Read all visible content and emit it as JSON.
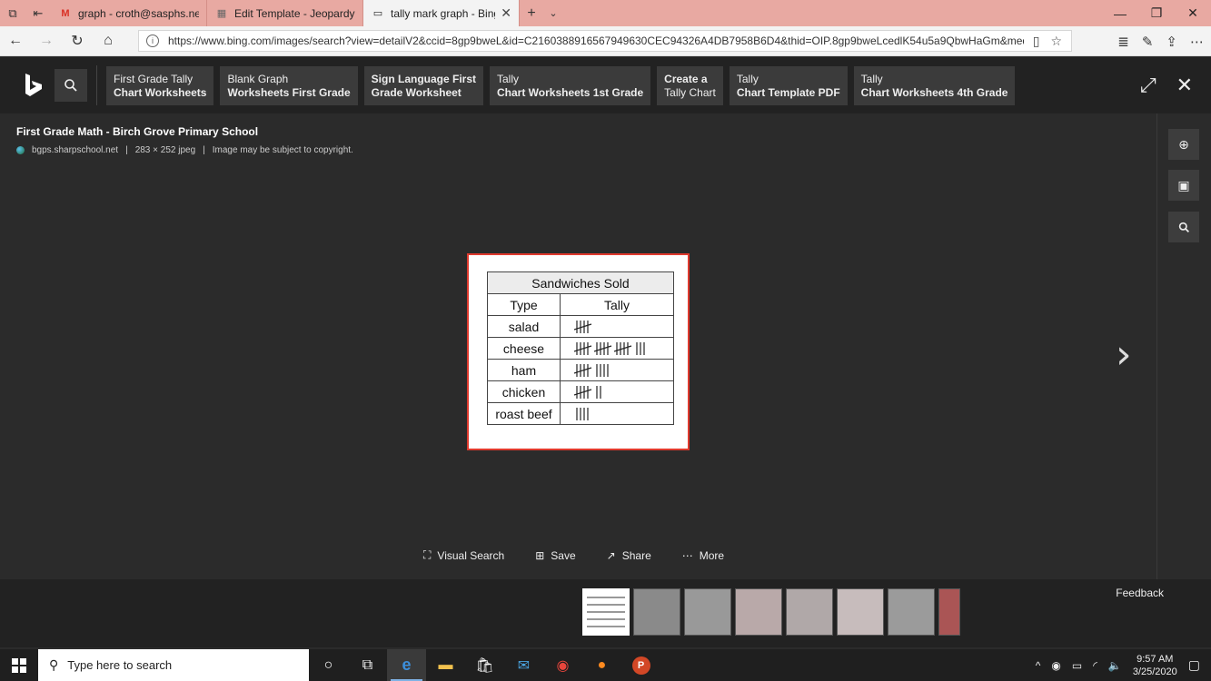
{
  "browser": {
    "tabs": [
      {
        "title": "graph - croth@sasphs.net -",
        "icon": "gmail-icon"
      },
      {
        "title": "Edit Template - JeopardyLat",
        "icon": "page-icon"
      },
      {
        "title": "tally mark graph - Bing",
        "icon": "tab-icon",
        "active": true
      }
    ],
    "url": "https://www.bing.com/images/search?view=detailV2&ccid=8gp9bweL&id=C2160388916567949630CEC94326A4DB7958B6D4&thid=OIP.8gp9bweLcedlK54u5a9QbwHaGm&mediaurl=http"
  },
  "bing": {
    "related": [
      {
        "line1": "First Grade Tally",
        "line2": "Chart Worksheets",
        "bold1": false
      },
      {
        "line1": "Blank Graph",
        "line2": "Worksheets First Grade",
        "bold1": false
      },
      {
        "line1": "Sign Language First",
        "line2": "Grade Worksheet",
        "bold1": true
      },
      {
        "line1": "Tally",
        "line2": "Chart Worksheets 1st Grade",
        "bold1": false
      },
      {
        "line1": "Create a",
        "line2": "Tally Chart",
        "bold1": true,
        "line2_normal": true
      },
      {
        "line1": "Tally",
        "line2": "Chart Template PDF",
        "bold1": false
      },
      {
        "line1": "Tally",
        "line2": "Chart Worksheets 4th Grade",
        "bold1": false
      }
    ],
    "detail": {
      "title": "First Grade Math - Birch Grove Primary School",
      "source": "bgps.sharpschool.net",
      "size": "283 × 252 jpeg",
      "copyright": "Image may be subject to copyright."
    },
    "actions": {
      "visual_search": "Visual Search",
      "save": "Save",
      "share": "Share",
      "more": "More"
    },
    "feedback": "Feedback"
  },
  "tally_chart": {
    "caption": "Sandwiches Sold",
    "col_type": "Type",
    "col_tally": "Tally",
    "rows": [
      {
        "type": "salad",
        "count": 5
      },
      {
        "type": "cheese",
        "count": 18
      },
      {
        "type": "ham",
        "count": 9
      },
      {
        "type": "chicken",
        "count": 7
      },
      {
        "type": "roast beef",
        "count": 4
      }
    ]
  },
  "taskbar": {
    "search_placeholder": "Type here to search",
    "time": "9:57 AM",
    "date": "3/25/2020"
  },
  "colors": {
    "tabbar": "#e8a9a2",
    "bing_bg": "#2b2b2b",
    "image_border": "#e03a2e"
  }
}
